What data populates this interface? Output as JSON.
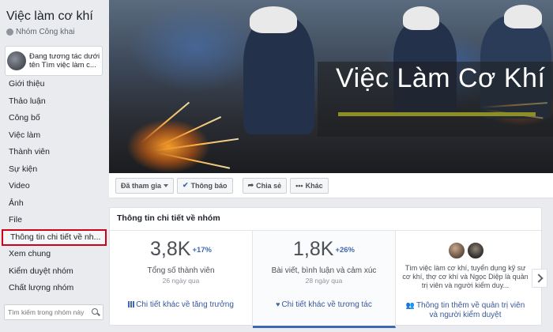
{
  "sidebar": {
    "group_name": "Việc làm cơ khí",
    "group_type": "Nhóm Công khai",
    "acting_as": "Đang tương tác dưới tên Tìm việc làm c...",
    "items": [
      {
        "label": "Giới thiệu"
      },
      {
        "label": "Thảo luận"
      },
      {
        "label": "Công bố"
      },
      {
        "label": "Việc làm"
      },
      {
        "label": "Thành viên"
      },
      {
        "label": "Sự kiện"
      },
      {
        "label": "Video"
      },
      {
        "label": "Ảnh"
      },
      {
        "label": "File"
      },
      {
        "label": "Thông tin chi tiết về nh..."
      },
      {
        "label": "Xem chung"
      },
      {
        "label": "Kiểm duyệt nhóm"
      },
      {
        "label": "Chất lượng nhóm"
      }
    ],
    "search_placeholder": "Tìm kiếm trong nhóm này"
  },
  "cover": {
    "title": "Việc Làm Cơ Khí"
  },
  "actions": {
    "joined": "Đã tham gia",
    "notifications": "Thông báo",
    "share": "Chia sẻ",
    "more": "Khác"
  },
  "info": {
    "title": "Thông tin chi tiết về nhóm",
    "members": {
      "value": "3,8K",
      "change": "+17%",
      "label": "Tổng số thành viên",
      "period": "26 ngày qua",
      "link": "Chi tiết khác về tăng trưởng"
    },
    "engagement": {
      "value": "1,8K",
      "change": "+26%",
      "label": "Bài viết, bình luận và cảm xúc",
      "period": "28 ngày qua",
      "link": "Chi tiết khác về tương tác"
    },
    "admins": {
      "text": "Tìm việc làm cơ khí, tuyển dụng kỹ sư cơ khí, thợ cơ khí và Ngọc Diệp là quản trị viên và người kiểm duy...",
      "link": "Thông tin thêm về quản trị viên và người kiểm duyệt"
    }
  },
  "colors": {
    "accent": "#4267b2",
    "link": "#365899",
    "highlight_border": "#d0021b",
    "background": "#e9ebee"
  }
}
